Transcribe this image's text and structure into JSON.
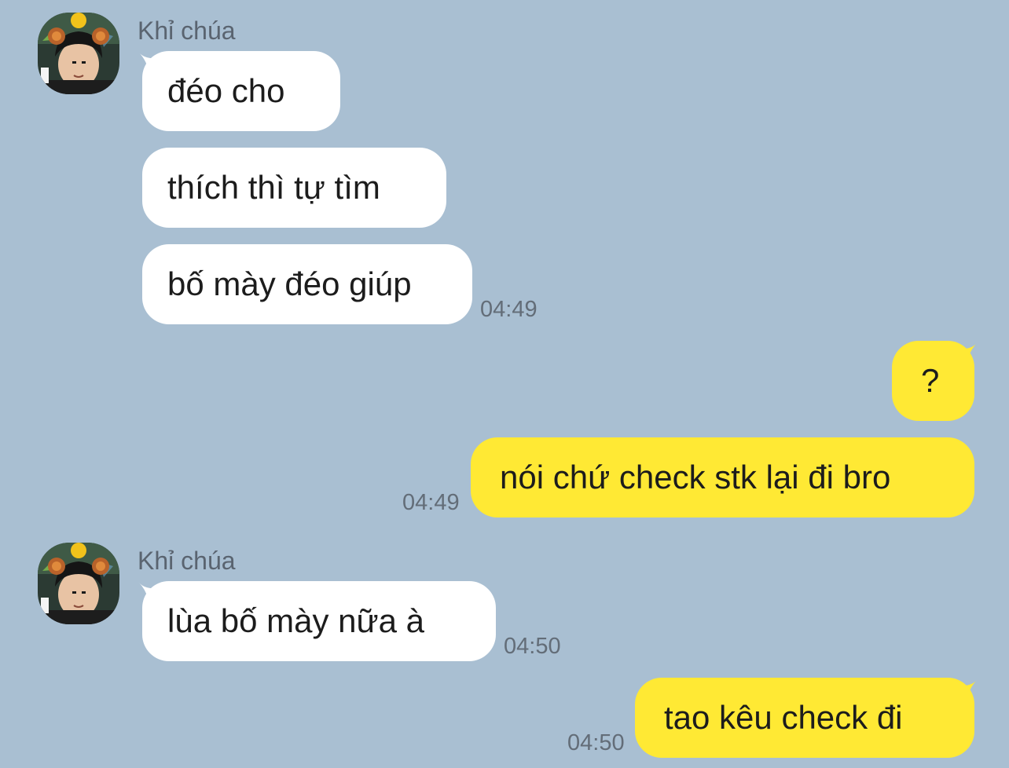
{
  "theme": {
    "background": "#a9bfd2",
    "incoming_bubble": "#ffffff",
    "outgoing_bubble": "#ffe934",
    "text_color": "#1c1c1c",
    "meta_color": "#636d78"
  },
  "messages": [
    {
      "direction": "incoming",
      "sender": "Khỉ chúa",
      "avatar_icon": "monkey-ears-avatar-icon",
      "lines": [
        "đéo cho",
        "thích thì tự tìm",
        "bố mày đéo giúp"
      ],
      "time": "04:49"
    },
    {
      "direction": "outgoing",
      "lines": [
        "?",
        "nói chứ check stk lại đi bro"
      ],
      "time": "04:49"
    },
    {
      "direction": "incoming",
      "sender": "Khỉ chúa",
      "avatar_icon": "monkey-ears-avatar-icon",
      "lines": [
        "lùa bố mày nữa à"
      ],
      "time": "04:50"
    },
    {
      "direction": "outgoing",
      "lines": [
        "tao kêu check đi"
      ],
      "time": "04:50"
    }
  ]
}
